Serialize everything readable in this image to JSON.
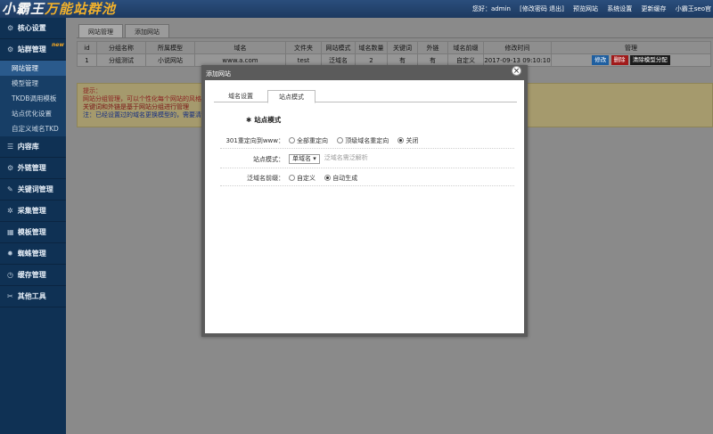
{
  "header": {
    "logo_main": "小霸王",
    "logo_accent": "万能站群池",
    "links": [
      "您好：admin",
      "[修改密码 退出]",
      "预览网站",
      "系统设置",
      "更新缓存",
      "小霸王seo官"
    ]
  },
  "sidebar": {
    "groups": [
      {
        "icon": "⚙",
        "label": "核心设置"
      },
      {
        "icon": "⚙",
        "label": "站群管理",
        "badge": "new",
        "items": [
          "网站管理",
          "模型管理",
          "TKDB调用模板",
          "站点优化设置",
          "自定义域名TKD"
        ],
        "active_index": 0
      },
      {
        "icon": "☰",
        "label": "内容库"
      },
      {
        "icon": "⚙",
        "label": "外链管理"
      },
      {
        "icon": "✎",
        "label": "关键词管理"
      },
      {
        "icon": "✲",
        "label": "采集管理"
      },
      {
        "icon": "▦",
        "label": "模板管理"
      },
      {
        "icon": "✹",
        "label": "蜘蛛管理"
      },
      {
        "icon": "◷",
        "label": "缓存管理"
      },
      {
        "icon": "✂",
        "label": "其他工具"
      }
    ]
  },
  "main": {
    "tabs": [
      "网站管理",
      "添加网站"
    ],
    "table": {
      "columns": [
        "id",
        "分组名称",
        "所属模型",
        "域名",
        "文件夹",
        "网站模式",
        "域名数量",
        "关键词",
        "外链",
        "域名前缀",
        "修改时间",
        "管理"
      ],
      "rows": [
        {
          "id": "1",
          "group": "分组测试",
          "model": "小说网站",
          "domain": "www.a.com",
          "folder": "test",
          "mode": "泛域名",
          "count": "2",
          "keywords": "有",
          "links": "有",
          "prefix": "自定义",
          "time": "2017-09-13 09:10:10"
        }
      ],
      "actions": [
        "修改",
        "删除",
        "清除模型分配"
      ]
    },
    "tips": {
      "title": "提示：",
      "line1": "网站分组管理，可以个性化每个网站的风格",
      "line2": "关键词和外链是基于网站分组进行管理",
      "line3": "注：已经设置过的域名更换模型的，需要清"
    }
  },
  "modal": {
    "title": "添加网站",
    "close": "×",
    "tabs": [
      "域名设置",
      "站点模式"
    ],
    "active_tab": 1,
    "section": "站点模式",
    "rows": {
      "redirect": {
        "label": "301重定向到www：",
        "options": [
          "全部重定向",
          "顶级域名重定向",
          "关闭"
        ],
        "selected": 2
      },
      "site_mode": {
        "label": "站点模式：",
        "value": "单域名",
        "hint": "泛域名需泛解析"
      },
      "prefix": {
        "label": "泛域名前缀：",
        "options": [
          "自定义",
          "自动生成"
        ],
        "selected": 1
      }
    }
  }
}
